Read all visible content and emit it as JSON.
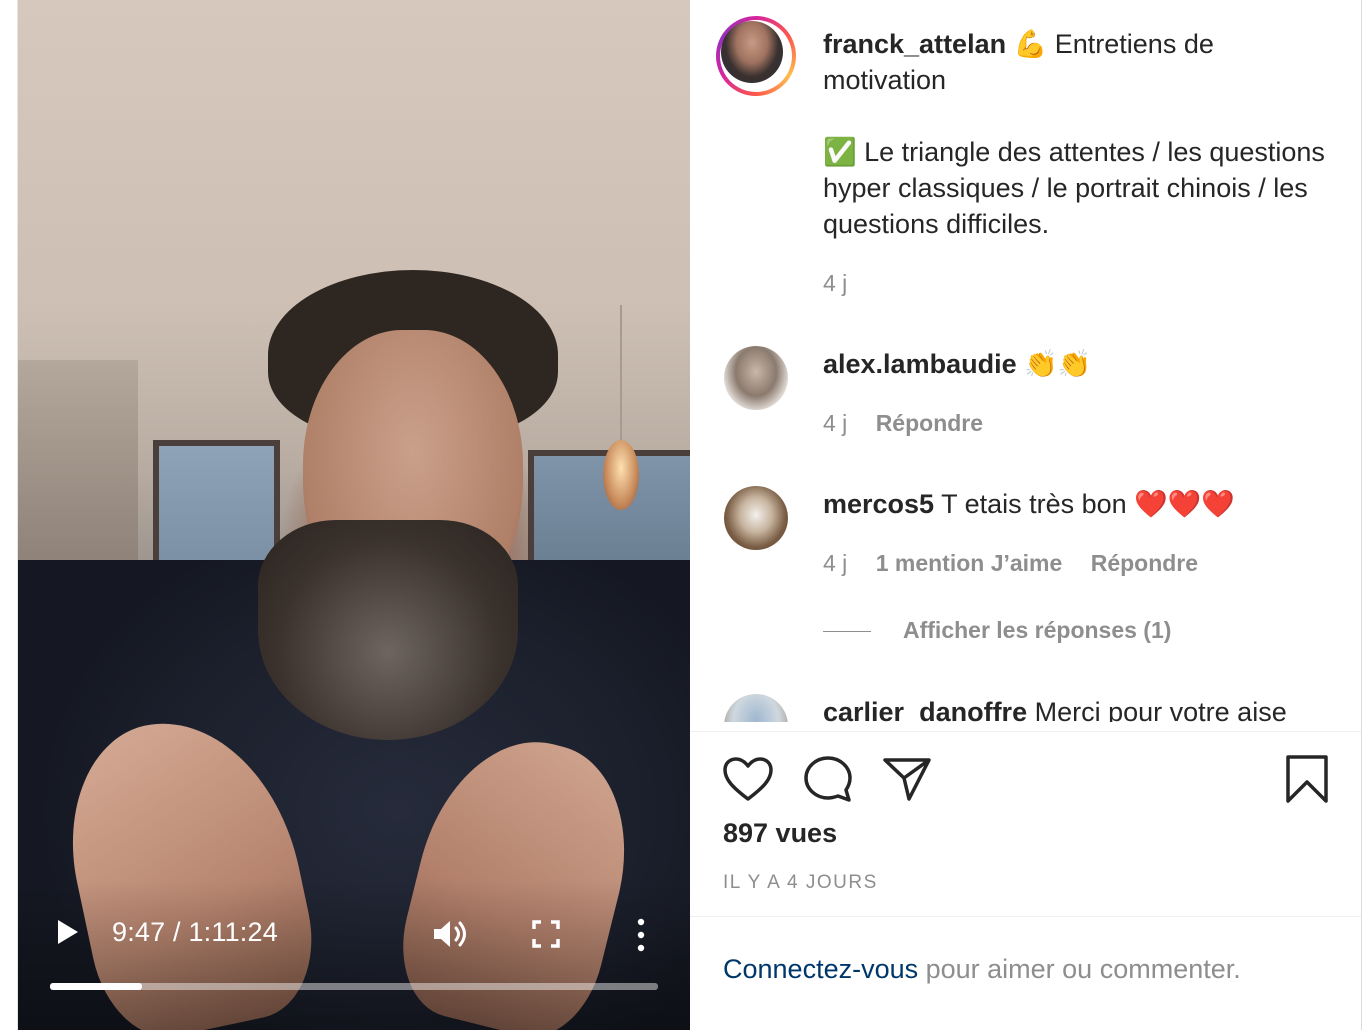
{
  "video": {
    "time_display": "9:47 / 1:11:24",
    "progress": 0.152,
    "icons": {
      "play": "play-icon",
      "volume": "volume-icon",
      "fullscreen": "fullscreen-icon",
      "more": "more-vertical-icon"
    }
  },
  "post": {
    "author": "franck_attelan",
    "caption_emoji": "💪",
    "caption_title": "Entretiens de motivation",
    "caption_check": "✅",
    "caption_body": "Le triangle des attentes / les questions hyper classiques / le portrait chinois / les questions difficiles.",
    "caption_age": "4 j"
  },
  "comments": [
    {
      "username": "alex.lambaudie",
      "text": "👏👏",
      "age": "4 j",
      "reply_label": "Répondre"
    },
    {
      "username": "mercos5",
      "text": "T etais très bon ❤️❤️❤️",
      "age": "4 j",
      "likes_label": "1 mention J’aime",
      "reply_label": "Répondre",
      "view_replies": "Afficher les réponses (1)"
    },
    {
      "username": "carlier_danoffre",
      "text": "Merci pour votre aise"
    }
  ],
  "actions": {
    "icons": [
      "heart-icon",
      "comment-icon",
      "share-icon",
      "bookmark-icon"
    ],
    "views": "897 vues",
    "posted": "IL Y A 4 JOURS"
  },
  "login": {
    "link": "Connectez-vous",
    "rest": " pour aimer ou commenter."
  },
  "colors": {
    "link": "#00376b",
    "secondary_text": "#8e8e8e",
    "primary_text": "#262626"
  }
}
